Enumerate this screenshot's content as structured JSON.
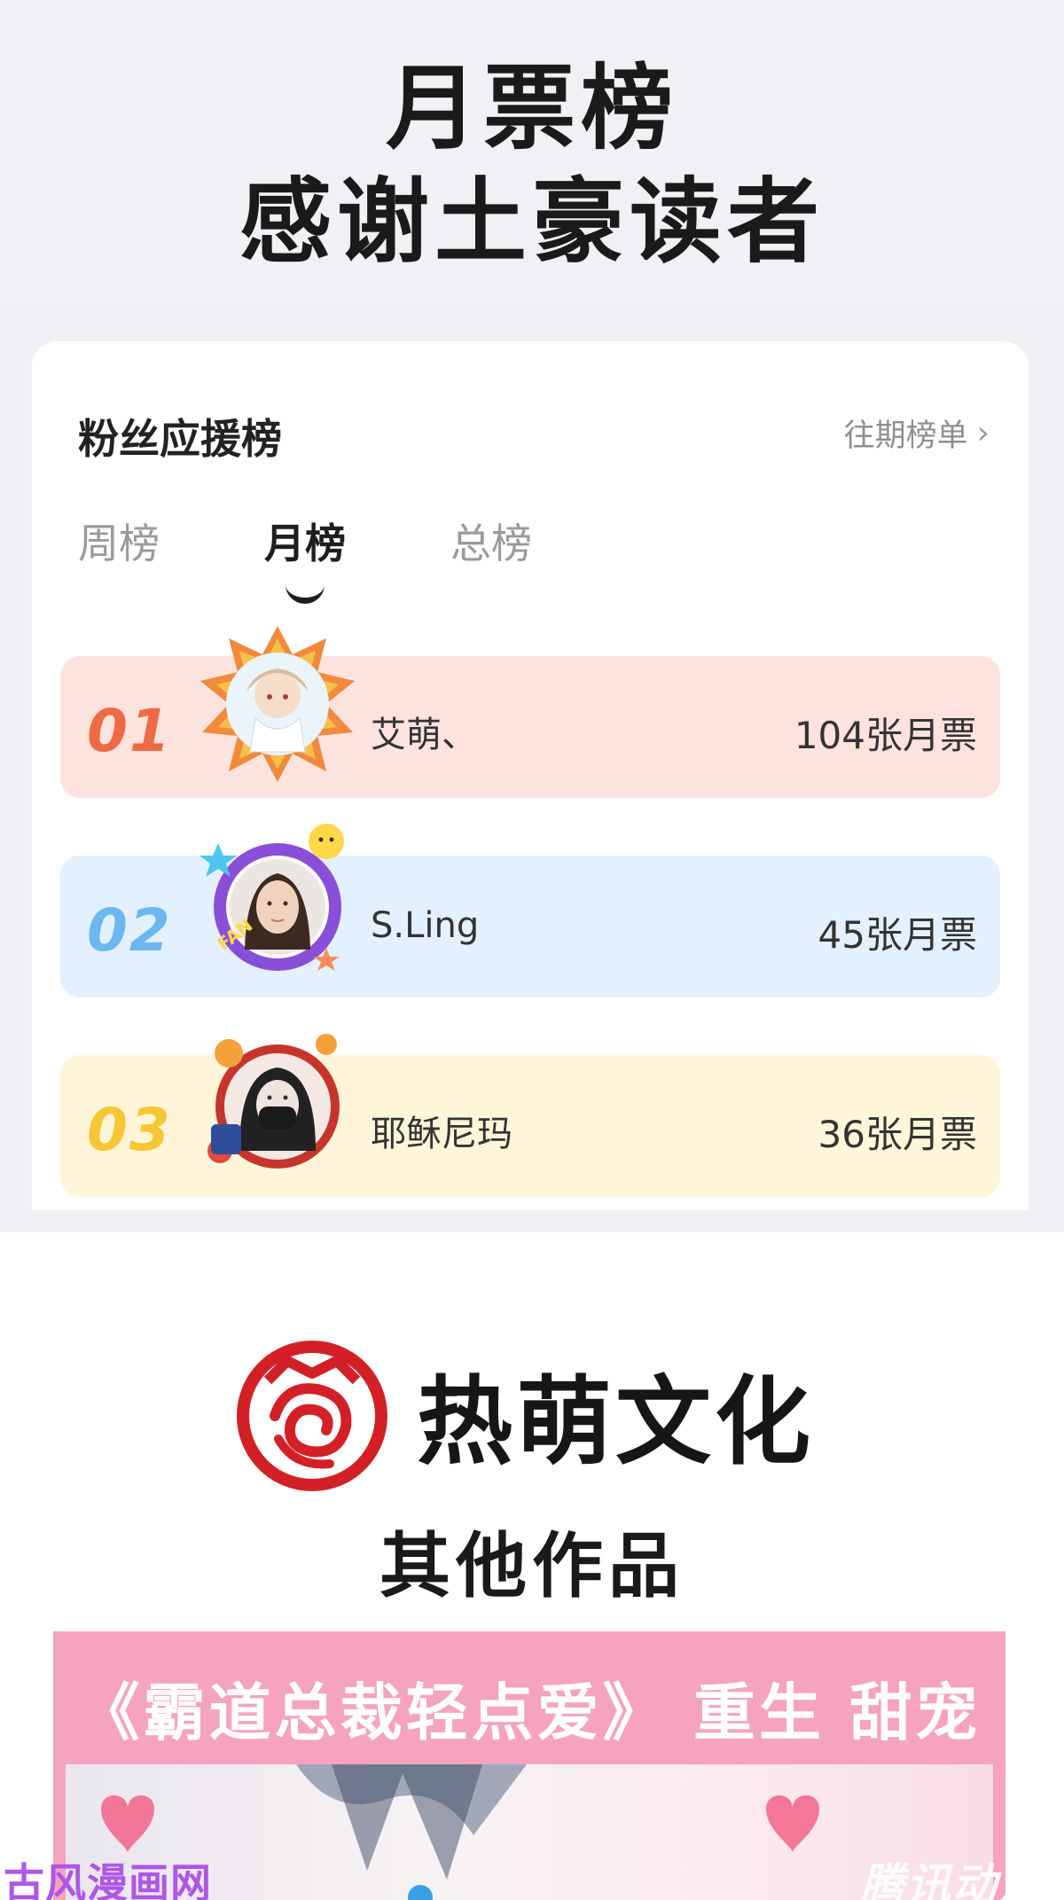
{
  "banner": {
    "line1": "月票榜",
    "line2": "感谢土豪读者"
  },
  "card": {
    "title": "粉丝应援榜",
    "history_link": "往期榜单",
    "tabs": [
      {
        "label": "周榜",
        "active": false
      },
      {
        "label": "月榜",
        "active": true
      },
      {
        "label": "总榜",
        "active": false
      }
    ],
    "ranking": [
      {
        "rank": "01",
        "name": "艾萌、",
        "votes": "104张月票"
      },
      {
        "rank": "02",
        "name": "S.Ling",
        "votes": "45张月票"
      },
      {
        "rank": "03",
        "name": "耶稣尼玛",
        "votes": "36张月票"
      }
    ]
  },
  "brand": {
    "name": "热萌文化",
    "subtitle": "其他作品",
    "logo_color": "#d32027"
  },
  "promo": {
    "title": "《霸道总裁轻点爱》 重生 甜宠 逆袭"
  },
  "watermarks": {
    "left": "古风漫画网",
    "right": "腾讯动漫"
  },
  "colors": {
    "rank1": "#ee6a45",
    "rank1_bg": "#fde3dd",
    "rank2": "#6cb7f0",
    "rank2_bg": "#e3f0fd",
    "rank3": "#f6c633",
    "rank3_bg": "#fff5d9",
    "promo_bg": "#f5a3bf"
  }
}
